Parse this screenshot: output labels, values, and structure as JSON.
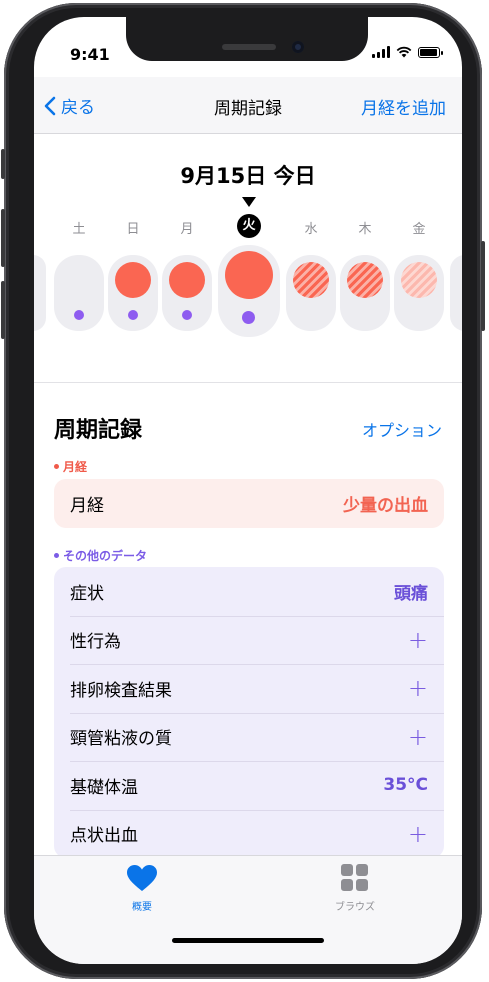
{
  "status_bar": {
    "time": "9:41"
  },
  "nav": {
    "back_label": "戻る",
    "title": "周期記録",
    "action_label": "月経を追加"
  },
  "date_strip": {
    "heading": "9月15日 今日",
    "days": [
      {
        "label": "土",
        "flow": "none",
        "dot": true
      },
      {
        "label": "日",
        "flow": "logged",
        "dot": true
      },
      {
        "label": "月",
        "flow": "logged",
        "dot": true
      },
      {
        "label": "火",
        "flow": "logged",
        "dot": true,
        "today": true
      },
      {
        "label": "水",
        "flow": "predicted",
        "dot": false
      },
      {
        "label": "木",
        "flow": "predicted",
        "dot": false
      },
      {
        "label": "金",
        "flow": "predicted-light",
        "dot": false
      }
    ]
  },
  "cycle_log": {
    "title": "周期記録",
    "options_label": "オプション",
    "period_group": {
      "label": "月経",
      "rows": [
        {
          "label": "月経",
          "value": "少量の出血"
        }
      ]
    },
    "other_group": {
      "label": "その他のデータ",
      "rows": [
        {
          "label": "症状",
          "value": "頭痛"
        },
        {
          "label": "性行為",
          "value": "+"
        },
        {
          "label": "排卵検査結果",
          "value": "+"
        },
        {
          "label": "頸管粘液の質",
          "value": "+"
        },
        {
          "label": "基礎体温",
          "value": "35°C"
        },
        {
          "label": "点状出血",
          "value": "+"
        }
      ]
    }
  },
  "tab_bar": {
    "tabs": [
      {
        "label": "概要",
        "icon": "heart-icon",
        "active": true
      },
      {
        "label": "ブラウズ",
        "icon": "grid-icon",
        "active": false
      }
    ]
  },
  "colors": {
    "accent": "#0a74e8",
    "period": "#fa6652",
    "period_group_label": "#f05a4a",
    "period_card_bg": "#fdeeec",
    "other_group_label": "#7b5ce6",
    "other_card_bg": "#efedfb",
    "data_dot": "#8e5cf0"
  }
}
